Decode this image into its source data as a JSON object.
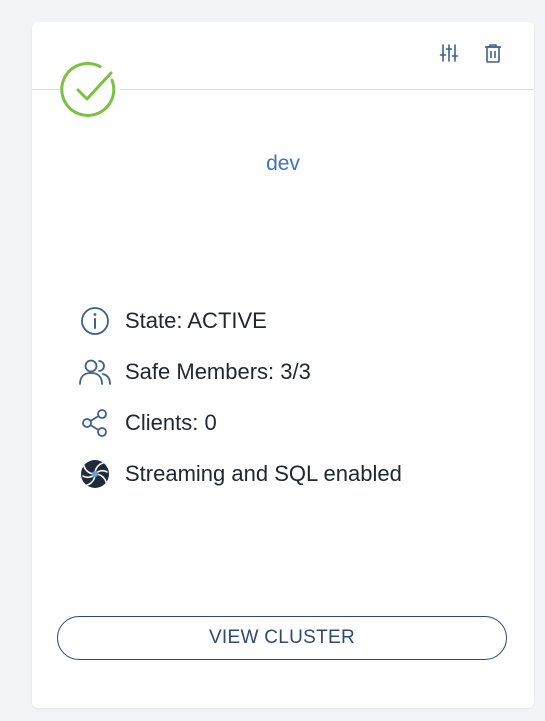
{
  "card": {
    "status_icon": "check-circle-icon",
    "status_color": "#7cc142",
    "toolbar": {
      "settings_icon": "sliders-icon",
      "delete_icon": "trash-icon"
    },
    "cluster_name": "dev",
    "info": [
      {
        "icon": "info-circle-icon",
        "text": "State: ACTIVE"
      },
      {
        "icon": "users-icon",
        "text": "Safe Members: 3/3"
      },
      {
        "icon": "share-icon",
        "text": "Clients: 0"
      },
      {
        "icon": "streaming-sql-icon",
        "text": "Streaming and SQL enabled"
      }
    ],
    "view_button_label": "VIEW CLUSTER",
    "accent_color": "#3f73b9",
    "button_color": "#2f4a72"
  }
}
